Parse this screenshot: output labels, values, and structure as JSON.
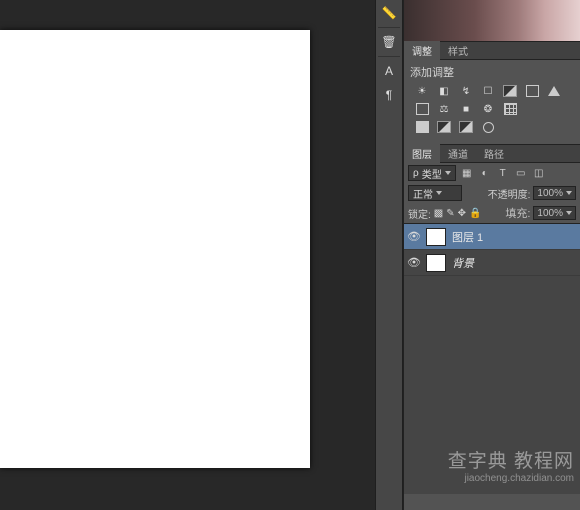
{
  "toolstrip": {
    "items": [
      {
        "name": "ruler-icon",
        "glyph": "📏"
      },
      {
        "name": "bucket-icon",
        "glyph": "🗑"
      },
      {
        "name": "text-a-icon",
        "glyph": "A"
      },
      {
        "name": "paragraph-icon",
        "glyph": "¶"
      }
    ]
  },
  "color_panel": {
    "tabs": [
      "调整",
      "样式"
    ],
    "active_tab": 0,
    "title": "添加调整"
  },
  "adjust_icons_row1": [
    "brightness",
    "levels",
    "curves",
    "exposure",
    "vibrance",
    "box",
    "triangle"
  ],
  "adjust_icons_row2": [
    "box",
    "balance",
    "bw",
    "mix",
    "grid"
  ],
  "adjust_icons_row3": [
    "box",
    "diag",
    "diag",
    "circle"
  ],
  "layers_panel": {
    "tabs": [
      "图层",
      "通道",
      "路径"
    ],
    "active_tab": 0,
    "filter_label": "类型",
    "filter_icons": [
      "image",
      "fx",
      "text",
      "shape",
      "smart"
    ],
    "blend_mode": "正常",
    "opacity_label": "不透明度:",
    "opacity_value": "100%",
    "lock_label": "锁定:",
    "fill_label": "填充:",
    "fill_value": "100%",
    "layers": [
      {
        "name": "图层 1",
        "selected": true,
        "italic": false
      },
      {
        "name": "背景",
        "selected": false,
        "italic": true
      }
    ]
  },
  "watermark": {
    "main": "查字典  教程网",
    "sub": "jiaocheng.chazidian.com"
  }
}
